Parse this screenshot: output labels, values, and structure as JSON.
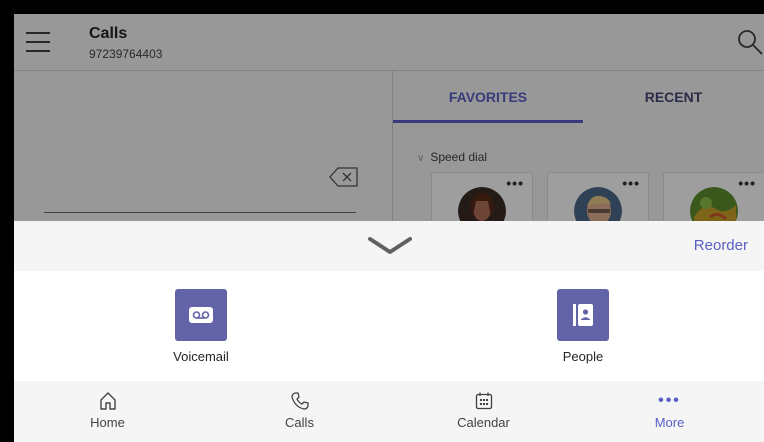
{
  "header": {
    "title": "Calls",
    "subtitle": "97239764403",
    "menu_icon": "hamburger-menu-icon",
    "search_icon": "search-icon"
  },
  "dialpad": {
    "backspace_icon": "backspace-icon"
  },
  "favorites": {
    "tabs": [
      {
        "label": "FAVORITES",
        "active": true
      },
      {
        "label": "RECENT",
        "active": false
      }
    ],
    "section_label": "Speed dial",
    "cards_more_label": "•••"
  },
  "sheet": {
    "collapse_icon": "chevron-down-icon",
    "reorder_label": "Reorder",
    "apps": [
      {
        "label": "Voicemail",
        "icon": "voicemail-icon"
      },
      {
        "label": "People",
        "icon": "contacts-book-icon"
      }
    ]
  },
  "nav": {
    "items": [
      {
        "label": "Home",
        "icon": "home-icon",
        "active": false
      },
      {
        "label": "Calls",
        "icon": "phone-icon",
        "active": false
      },
      {
        "label": "Calendar",
        "icon": "calendar-icon",
        "active": false
      },
      {
        "label": "More",
        "icon": "more-dots-icon",
        "active": true
      }
    ],
    "more_glyph": "•••"
  },
  "colors": {
    "accent": "#5b5fc7",
    "tile": "#6264a7",
    "surface": "#f5f5f5",
    "overlay": "rgba(0,0,0,0.38)"
  }
}
